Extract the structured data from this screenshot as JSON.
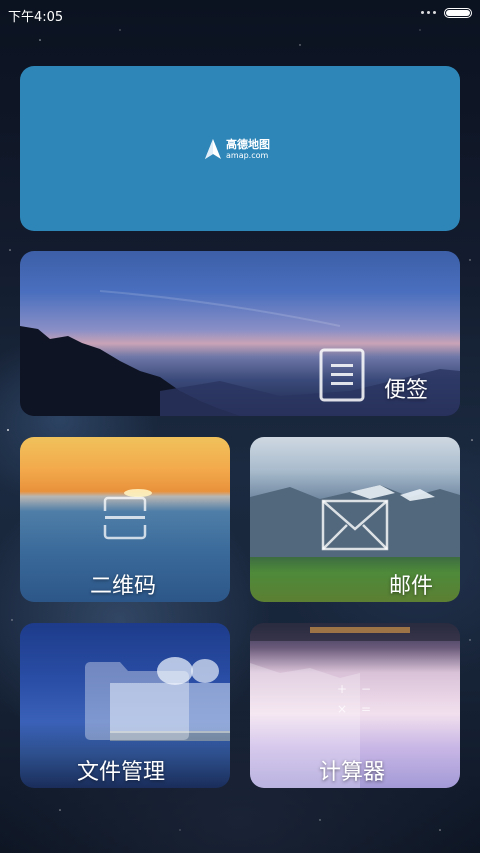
{
  "status_bar": {
    "time": "下午4:05"
  },
  "tiles": {
    "amap": {
      "name": "高德地图",
      "url": "amap.com"
    },
    "notes": {
      "label": "便签"
    },
    "qr": {
      "label": "二维码"
    },
    "mail": {
      "label": "邮件"
    },
    "files": {
      "label": "文件管理"
    },
    "calc": {
      "label": "计算器"
    }
  }
}
